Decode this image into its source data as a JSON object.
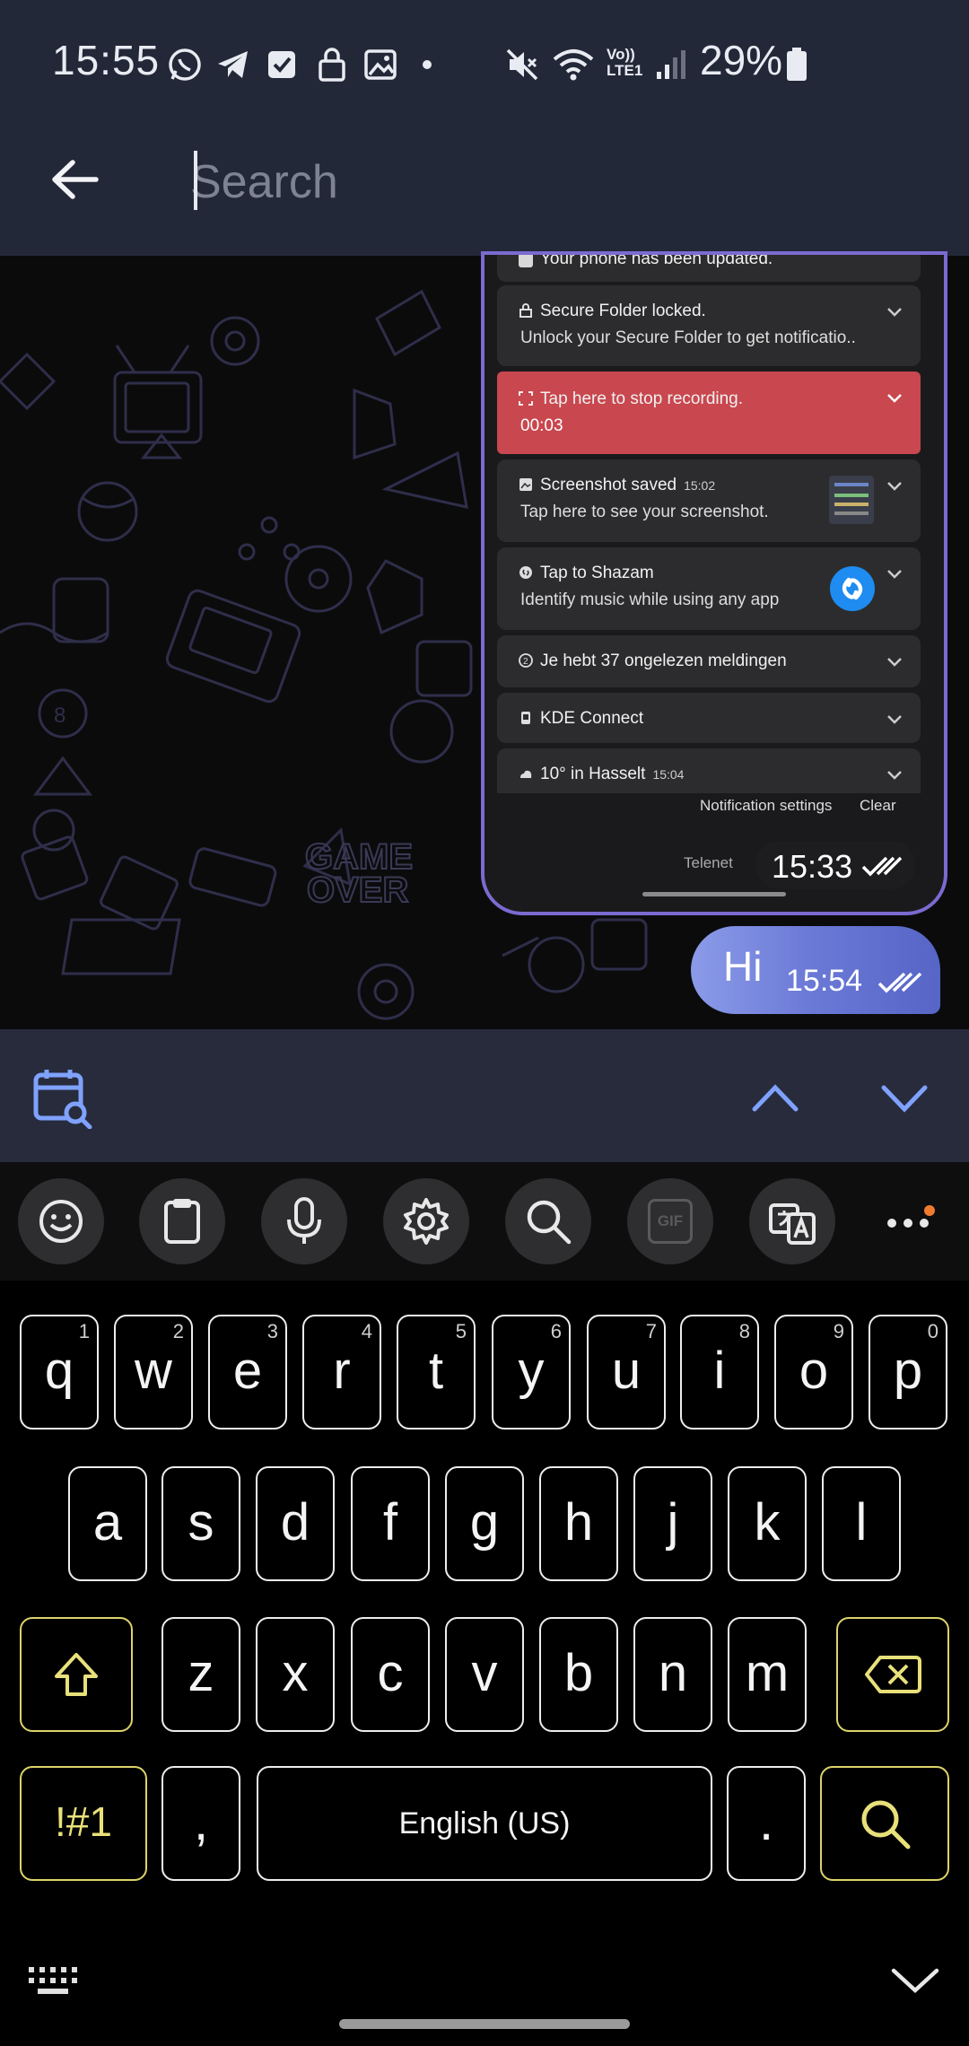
{
  "status_bar": {
    "time": "15:55",
    "battery_percent": "29%",
    "icons": [
      "whatsapp-icon",
      "telegram-icon",
      "checkbox-icon",
      "lock-icon",
      "image-icon",
      "dot-icon",
      "mute-icon",
      "wifi-icon",
      "volte-icon",
      "signal-icon",
      "battery-icon"
    ],
    "volte_label": "Vo)) LTE1"
  },
  "search_header": {
    "placeholder": "Search"
  },
  "screenshot_message": {
    "notifications": [
      {
        "title": "Your phone has been updated.",
        "subtitle": "",
        "time": ""
      },
      {
        "title": "Secure Folder locked.",
        "subtitle": "Unlock your Secure Folder to get notificatio..",
        "time": ""
      },
      {
        "title": "Tap here to stop recording.",
        "subtitle": "00:03",
        "time": ""
      },
      {
        "title": "Screenshot saved",
        "subtitle": "Tap here to see your screenshot.",
        "time": "15:02"
      },
      {
        "title": "Tap to Shazam",
        "subtitle": "Identify music while using any app",
        "time": ""
      },
      {
        "title": "Je hebt 37 ongelezen meldingen",
        "subtitle": "",
        "time": ""
      },
      {
        "title": "KDE Connect",
        "subtitle": "",
        "time": ""
      },
      {
        "title": "10° in Hasselt",
        "subtitle": "",
        "time": "15:04"
      }
    ],
    "notification_settings": "Notification settings",
    "clear": "Clear",
    "carrier": "Telenet",
    "timestamp": "15:33"
  },
  "sent_message": {
    "text": "Hi",
    "timestamp": "15:54"
  },
  "keyboard": {
    "toolbar_icons": [
      "emoji-icon",
      "clipboard-icon",
      "microphone-icon",
      "settings-icon",
      "search-icon",
      "gif-icon",
      "translate-icon",
      "more-icon"
    ],
    "gif_label": "GIF",
    "row1": [
      {
        "key": "q",
        "hint": "1"
      },
      {
        "key": "w",
        "hint": "2"
      },
      {
        "key": "e",
        "hint": "3"
      },
      {
        "key": "r",
        "hint": "4"
      },
      {
        "key": "t",
        "hint": "5"
      },
      {
        "key": "y",
        "hint": "6"
      },
      {
        "key": "u",
        "hint": "7"
      },
      {
        "key": "i",
        "hint": "8"
      },
      {
        "key": "o",
        "hint": "9"
      },
      {
        "key": "p",
        "hint": "0"
      }
    ],
    "row2": [
      "a",
      "s",
      "d",
      "f",
      "g",
      "h",
      "j",
      "k",
      "l"
    ],
    "row3": [
      "z",
      "x",
      "c",
      "v",
      "b",
      "n",
      "m"
    ],
    "symbols_label": "!#1",
    "comma_label": ",",
    "space_label": "English (US)",
    "period_label": "."
  },
  "colors": {
    "header_bg": "#232838",
    "accent_bubble": "#6a78d6",
    "recording_red": "#c9474f",
    "key_yellow": "#dcd36a"
  }
}
